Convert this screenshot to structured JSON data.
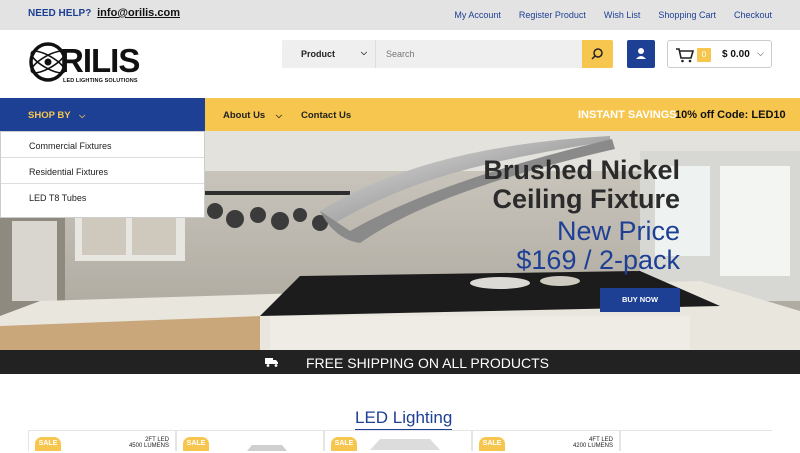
{
  "topbar": {
    "help_label": "NEED HELP?",
    "email": "info@orilis.com",
    "links": [
      "My Account",
      "Register Product",
      "Wish List",
      "Shopping Cart",
      "Checkout"
    ]
  },
  "logo": {
    "text": "RILIS",
    "sub": "LED LIGHTING SOLUTIONS"
  },
  "search": {
    "category": "Product",
    "placeholder": "Search"
  },
  "cart": {
    "count": "0",
    "amount": "$ 0.00"
  },
  "nav": {
    "shop_by": "SHOP BY",
    "items": [
      "About Us",
      "Contact Us"
    ],
    "savings": "INSTANT SAVINGS",
    "code": "10% off Code: LED10"
  },
  "dropdown": [
    "Commercial Fixtures",
    "Residential Fixtures",
    "LED T8 Tubes"
  ],
  "hero": {
    "title_line1": "Brushed Nickel",
    "title_line2": "Ceiling Fixture",
    "price_line1": "New Price",
    "price_line2": "$169 / 2-pack",
    "button": "BUY NOW"
  },
  "shipping": "FREE SHIPPING ON ALL PRODUCTS",
  "section_title": "LED Lighting",
  "products": [
    {
      "badge": "SALE",
      "label1": "2FT LED",
      "label2": "4500 LUMENS"
    },
    {
      "badge": "SALE",
      "label1": "",
      "label2": ""
    },
    {
      "badge": "SALE",
      "label1": "",
      "label2": ""
    },
    {
      "badge": "SALE",
      "label1": "4FT LED",
      "label2": "4200 LUMENS"
    }
  ],
  "colors": {
    "brand_blue": "#1d3f94",
    "accent_yellow": "#f6c64f",
    "dark": "#222222"
  }
}
